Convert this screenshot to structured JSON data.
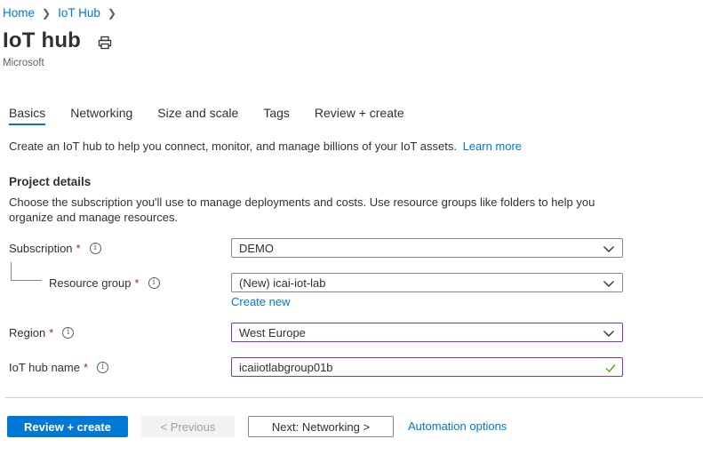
{
  "breadcrumb": {
    "items": [
      "Home",
      "IoT Hub"
    ]
  },
  "page": {
    "title": "IoT hub",
    "subtitle": "Microsoft"
  },
  "tabs": [
    {
      "label": "Basics",
      "active": true
    },
    {
      "label": "Networking"
    },
    {
      "label": "Size and scale"
    },
    {
      "label": "Tags"
    },
    {
      "label": "Review + create"
    }
  ],
  "intro": {
    "text": "Create an IoT hub to help you connect, monitor, and manage billions of your IoT assets.",
    "link": "Learn more"
  },
  "project": {
    "title": "Project details",
    "description": "Choose the subscription you'll use to manage deployments and costs. Use resource groups like folders to help you organize and manage resources."
  },
  "form": {
    "subscription": {
      "label": "Subscription",
      "required": "*",
      "value": "DEMO"
    },
    "resource_group": {
      "label": "Resource group",
      "required": "*",
      "value": "(New) icai-iot-lab",
      "create_new": "Create new"
    },
    "region": {
      "label": "Region",
      "required": "*",
      "value": "West Europe"
    },
    "hub_name": {
      "label": "IoT hub name",
      "required": "*",
      "value": "icaiiotlabgroup01b"
    }
  },
  "footer": {
    "review_create": "Review + create",
    "previous": "< Previous",
    "next": "Next: Networking >",
    "automation": "Automation options"
  },
  "colors": {
    "accent": "#0078d4",
    "focus_border": "#7c3aa3",
    "required": "#a4262c",
    "valid": "#57a300"
  },
  "icons": [
    "chevron-right-icon",
    "print-icon",
    "info-icon",
    "chevron-down-icon",
    "checkmark-icon"
  ]
}
